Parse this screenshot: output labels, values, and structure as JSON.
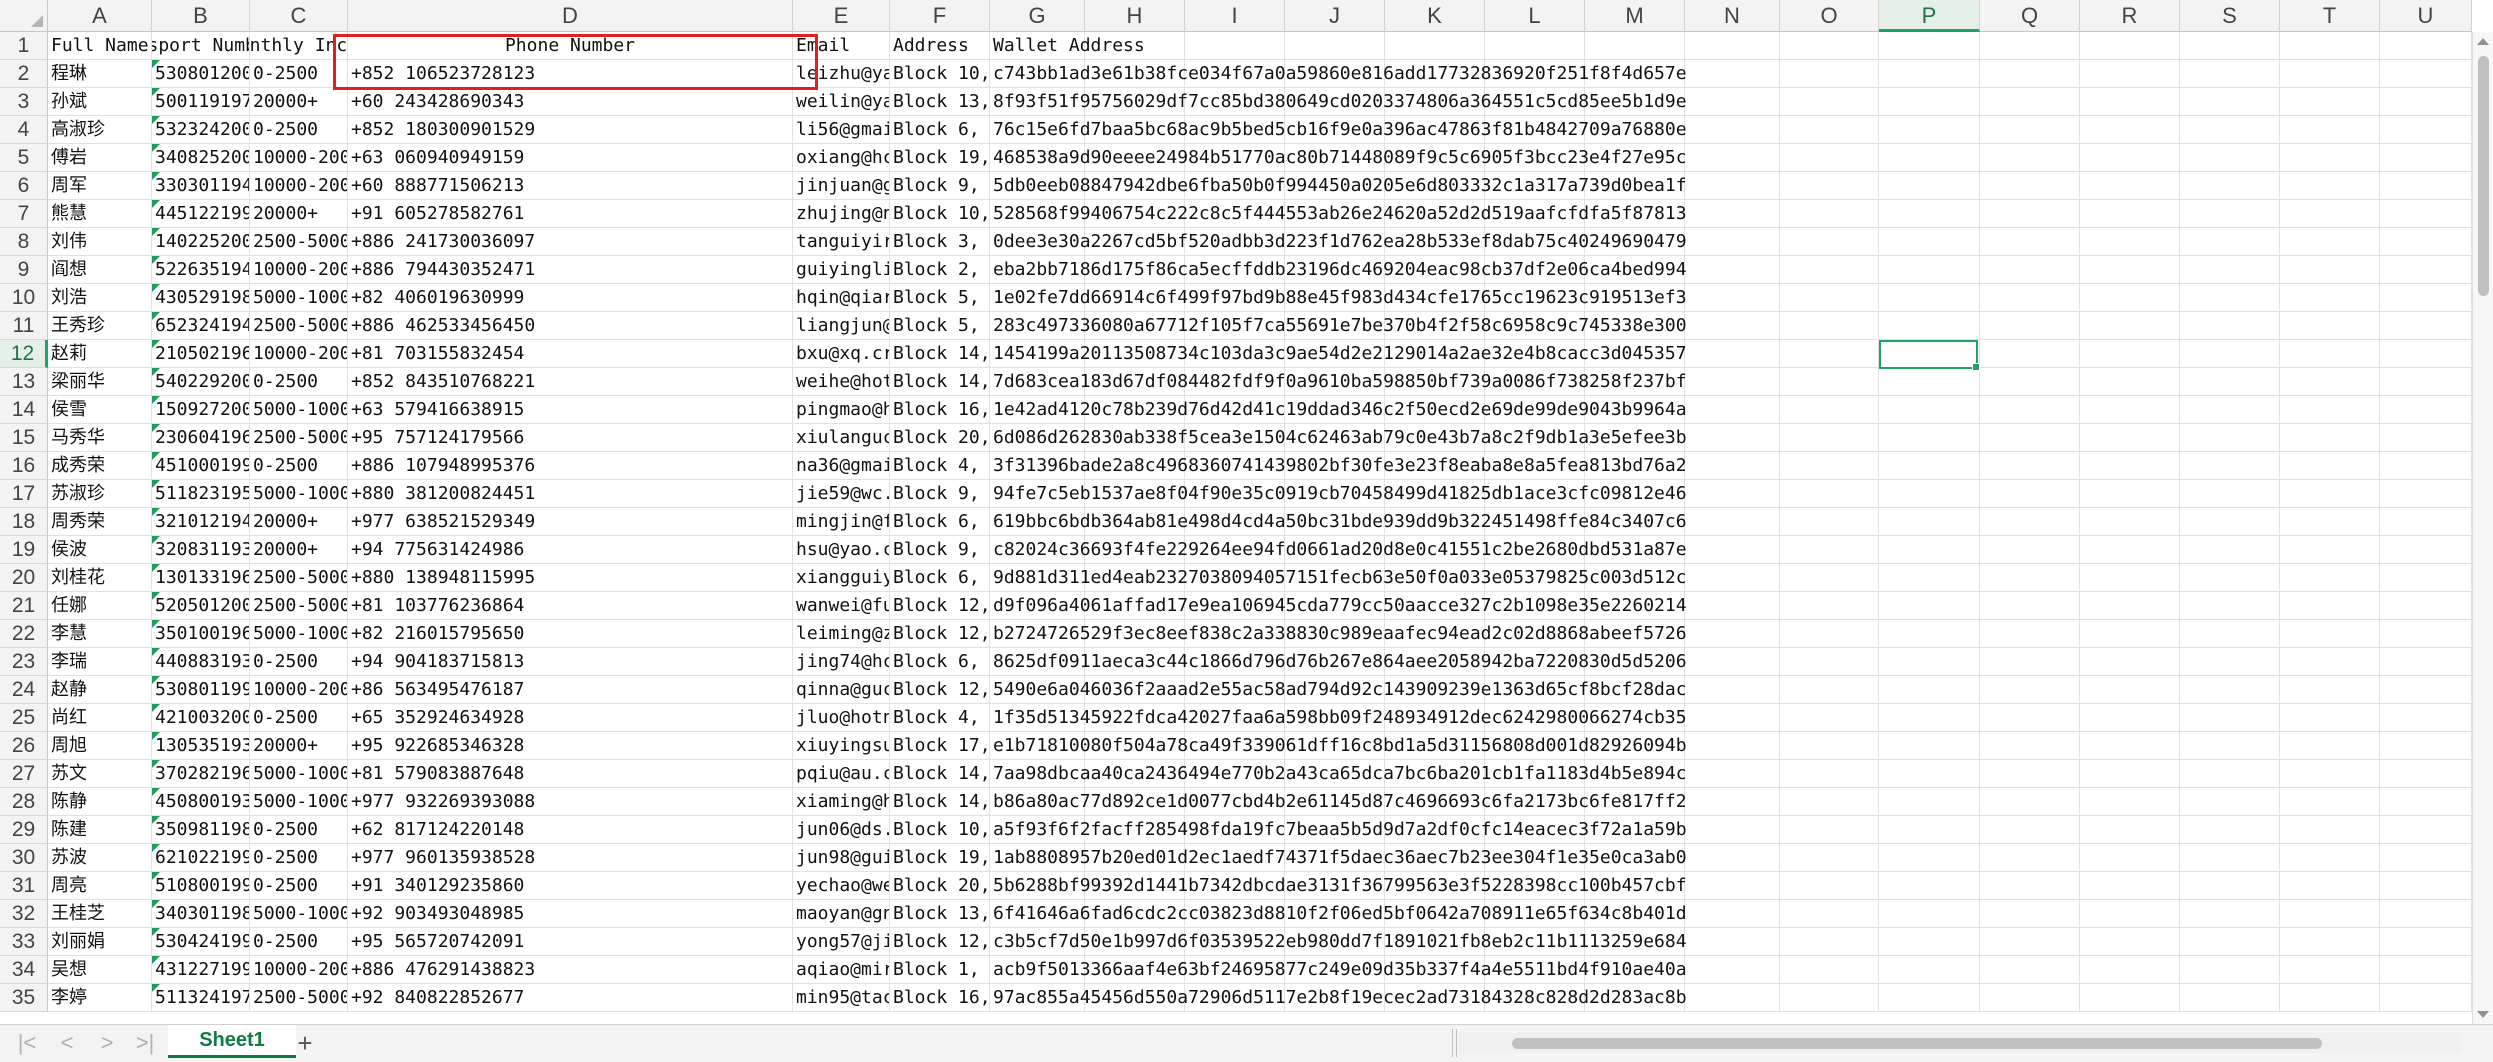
{
  "columns": [
    "A",
    "B",
    "C",
    "D",
    "E",
    "F",
    "G",
    "H",
    "I",
    "J",
    "K",
    "L",
    "M",
    "N",
    "O",
    "P",
    "Q",
    "R",
    "S",
    "T",
    "U"
  ],
  "selected_column": "P",
  "selected_row": "12",
  "headers": [
    "Full Name",
    "Passport Number",
    "Monthly Income",
    "Phone Number",
    "Email",
    "Address",
    "Wallet Address"
  ],
  "rows": [
    [
      "2",
      "程琳",
      "530801200",
      "0-2500",
      "+852 106523728123",
      "leizhu@ya",
      "Block 10,",
      "c743bb1ad3e61b38fce034f67a0a59860e816add17732836920f251f8f4d657e"
    ],
    [
      "3",
      "孙斌",
      "500119197",
      "20000+",
      "+60 243428690343",
      "weilin@ya",
      "Block 13,",
      "8f93f51f95756029df7cc85bd380649cd0203374806a364551c5cd85ee5b1d9e"
    ],
    [
      "4",
      "高淑珍",
      "532324200",
      "0-2500",
      "+852 180300901529",
      "li56@gmai",
      "Block 6,",
      "76c15e6fd7baa5bc68ac9b5bed5cb16f9e0a396ac47863f81b4842709a76880e"
    ],
    [
      "5",
      "傅岩",
      "340825200",
      "10000-200",
      "+63 060940949159",
      "oxiang@hc",
      "Block 19,",
      "468538a9d90eeee24984b51770ac80b71448089f9c5c6905f3bcc23e4f27e95c"
    ],
    [
      "6",
      "周军",
      "330301194",
      "10000-200",
      "+60 888771506213",
      "jinjuan@g",
      "Block 9,",
      "5db0eeb08847942dbe6fba50b0f994450a0205e6d803332c1a317a739d0bea1f"
    ],
    [
      "7",
      "熊慧",
      "445122199",
      "20000+",
      "+91 605278582761",
      "zhujing@n",
      "Block 10,",
      "528568f99406754c222c8c5f444553ab26e24620a52d2d519aafcfdfa5f87813"
    ],
    [
      "8",
      "刘伟",
      "140225200",
      "2500-5000",
      "+886 241730036097",
      "tanguiyir",
      "Block 3,",
      "0dee3e30a2267cd5bf520adbb3d223f1d762ea28b533ef8dab75c40249690479"
    ],
    [
      "9",
      "阎想",
      "522635194",
      "10000-200",
      "+886 794430352471",
      "guiyingli",
      "Block 2,",
      "eba2bb7186d175f86ca5ecffddb23196dc469204eac98cb37df2e06ca4bed994"
    ],
    [
      "10",
      "刘浩",
      "430529198",
      "5000-1000",
      "+82 406019630999",
      "hqin@qiar",
      "Block 5,",
      "1e02fe7dd66914c6f499f97bd9b88e45f983d434cfe1765cc19623c919513ef3"
    ],
    [
      "11",
      "王秀珍",
      "652324194",
      "2500-5000",
      "+886 462533456450",
      "liangjun@",
      "Block 5,",
      "283c497336080a67712f105f7ca55691e7be370b4f2f58c6958c9c745338e300"
    ],
    [
      "12",
      "赵莉",
      "210502196",
      "10000-200",
      "+81 703155832454",
      "bxu@xq.cr",
      "Block 14,",
      "1454199a20113508734c103da3c9ae54d2e2129014a2ae32e4b8cacc3d045357"
    ],
    [
      "13",
      "梁丽华",
      "540229200",
      "0-2500",
      "+852 843510768221",
      "weihe@hot",
      "Block 14,",
      "7d683cea183d67df084482fdf9f0a9610ba598850bf739a0086f738258f237bf"
    ],
    [
      "14",
      "侯雪",
      "150927200",
      "5000-1000",
      "+63 579416638915",
      "pingmao@h",
      "Block 16,",
      "1e42ad4120c78b239d76d42d41c19ddad346c2f50ecd2e69de99de9043b9964a"
    ],
    [
      "15",
      "马秀华",
      "230604196",
      "2500-5000",
      "+95 757124179566",
      "xiulanguc",
      "Block 20,",
      "6d086d262830ab338f5cea3e1504c62463ab79c0e43b7a8c2f9db1a3e5efee3b"
    ],
    [
      "16",
      "成秀荣",
      "451000199",
      "0-2500",
      "+886 107948995376",
      "na36@gmai",
      "Block 4,",
      "3f31396bade2a8c4968360741439802bf30fe3e23f8eaba8e8a5fea813bd76a2"
    ],
    [
      "17",
      "苏淑珍",
      "511823195",
      "5000-1000",
      "+880 381200824451",
      "jie59@wc.",
      "Block 9,",
      "94fe7c5eb1537ae8f04f90e35c0919cb70458499d41825db1ace3cfc09812e46"
    ],
    [
      "18",
      "周秀荣",
      "321012194",
      "20000+",
      "+977 638521529349",
      "mingjin@f",
      "Block 6,",
      "619bbc6bdb364ab81e498d4cd4a50bc31bde939dd9b322451498ffe84c3407c6"
    ],
    [
      "19",
      "侯波",
      "320831193",
      "20000+",
      "+94 775631424986",
      "hsu@yao.c",
      "Block 9,",
      "c82024c36693f4fe229264ee94fd0661ad20d8e0c41551c2be2680dbd531a87e"
    ],
    [
      "20",
      "刘桂花",
      "130133196",
      "2500-5000",
      "+880 138948115995",
      "xiangguiy",
      "Block 6,",
      "9d881d311ed4eab2327038094057151fecb63e50f0a033e05379825c003d512c"
    ],
    [
      "21",
      "任娜",
      "520501200",
      "2500-5000",
      "+81 103776236864",
      "wanwei@fu",
      "Block 12,",
      "d9f096a4061affad17e9ea106945cda779cc50aacce327c2b1098e35e2260214"
    ],
    [
      "22",
      "李慧",
      "350100196",
      "5000-1000",
      "+82 216015795650",
      "leiming@z",
      "Block 12,",
      "b2724726529f3ec8eef838c2a338830c989eaafec94ead2c02d8868abeef5726"
    ],
    [
      "23",
      "李瑞",
      "440883193",
      "0-2500",
      "+94 904183715813",
      "jing74@hc",
      "Block 6,",
      "8625df0911aeca3c44c1866d796d76b267e864aee2058942ba7220830d5d5206"
    ],
    [
      "24",
      "赵静",
      "530801199",
      "10000-200",
      "+86 563495476187",
      "qinna@guc",
      "Block 12,",
      "5490e6a046036f2aaad2e55ac58ad794d92c143909239e1363d65cf8bcf28dac"
    ],
    [
      "25",
      "尚红",
      "421003200",
      "0-2500",
      "+65 352924634928",
      "jluo@hotn",
      "Block 4,",
      "1f35d51345922fdca42027faa6a598bb09f248934912dec6242980066274cb35"
    ],
    [
      "26",
      "周旭",
      "130535193",
      "20000+",
      "+95 922685346328",
      "xiuyingsu",
      "Block 17,",
      "e1b71810080f504a78ca49f339061dff16c8bd1a5d31156808d001d82926094b"
    ],
    [
      "27",
      "苏文",
      "370282196",
      "5000-1000",
      "+81 579083887648",
      "pqiu@au.c",
      "Block 14,",
      "7aa98dbcaa40ca2436494e770b2a43ca65dca7bc6ba201cb1fa1183d4b5e894c"
    ],
    [
      "28",
      "陈静",
      "450800193",
      "5000-1000",
      "+977 932269393088",
      "xiaming@h",
      "Block 14,",
      "b86a80ac77d892ce1d0077cbd4b2e61145d87c4696693c6fa2173bc6fe817ff2"
    ],
    [
      "29",
      "陈建",
      "350981198",
      "0-2500",
      "+62 817124220148",
      "jun06@ds.",
      "Block 10,",
      "a5f93f6f2facff285498fda19fc7beaa5b5d9d7a2df0cfc14eacec3f72a1a59b"
    ],
    [
      "30",
      "苏波",
      "621022199",
      "0-2500",
      "+977 960135938528",
      "jun98@gui",
      "Block 19,",
      "1ab8808957b20ed01d2ec1aedf74371f5daec36aec7b23ee304f1e35e0ca3ab0"
    ],
    [
      "31",
      "周亮",
      "510800199",
      "0-2500",
      "+91 340129235860",
      "yechao@we",
      "Block 20,",
      "5b6288bf99392d1441b7342dbcdae3131f36799563e3f5228398cc100b457cbf"
    ],
    [
      "32",
      "王桂芝",
      "340301198",
      "5000-1000",
      "+92 903493048985",
      "maoyan@gn",
      "Block 13,",
      "6f41646a6fad6cdc2cc03823d8810f2f06ed5bf0642a708911e65f634c8b401d"
    ],
    [
      "33",
      "刘丽娟",
      "530424199",
      "0-2500",
      "+95 565720742091",
      "yong57@ji",
      "Block 12,",
      "c3b5cf7d50e1b997d6f03539522eb980dd7f1891021fb8eb2c11b1113259e684"
    ],
    [
      "34",
      "吴想",
      "431227199",
      "10000-200",
      "+886 476291438823",
      "aqiao@mir",
      "Block 1,",
      "acb9f5013366aaf4e63bf24695877c249e09d35b337f4a4e5511bd4f910ae40a"
    ],
    [
      "35",
      "李婷",
      "511324197",
      "2500-5000",
      "+92 840822852677",
      "min95@tac",
      "Block 16,",
      "97ac855a45456d550a72906d5117e2b8f19ecec2ad73184328c828d2d283ac8b"
    ]
  ],
  "sheet_tab": "Sheet1",
  "add_sheet": "+",
  "nav": [
    "|<",
    "<",
    ">",
    ">|"
  ]
}
